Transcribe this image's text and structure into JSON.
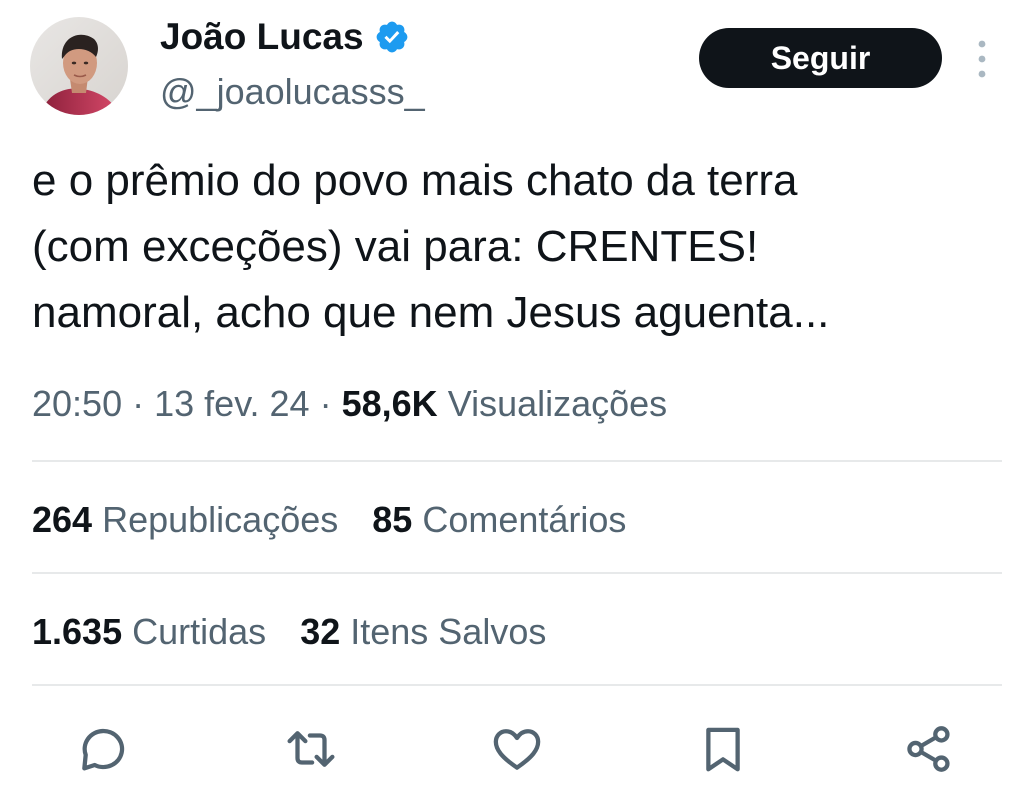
{
  "author": {
    "display_name": "João Lucas",
    "handle": "@_joaolucasss_",
    "verified": true,
    "verified_color": "#1d9bf0"
  },
  "follow_button": {
    "label": "Seguir"
  },
  "tweet": {
    "text": "e o prêmio do povo mais chato da terra\n(com exceções) vai para:  CRENTES!\nnamoral, acho que nem Jesus aguenta..."
  },
  "meta": {
    "time": "20:50",
    "separator": "·",
    "date": "13 fev. 24",
    "views_count": "58,6K",
    "views_label": "Visualizações"
  },
  "stats": {
    "reposts_count": "264",
    "reposts_label": "Republicações",
    "comments_count": "85",
    "comments_label": "Comentários",
    "likes_count": "1.635",
    "likes_label": "Curtidas",
    "saves_count": "32",
    "saves_label": "Itens Salvos"
  },
  "actions": [
    "reply-icon",
    "repost-icon",
    "like-icon",
    "bookmark-icon",
    "share-icon"
  ],
  "colors": {
    "text_primary": "#0f1419",
    "text_secondary": "#536471",
    "divider": "#e7e9ea",
    "button_bg": "#0f1419",
    "button_text": "#ffffff"
  }
}
